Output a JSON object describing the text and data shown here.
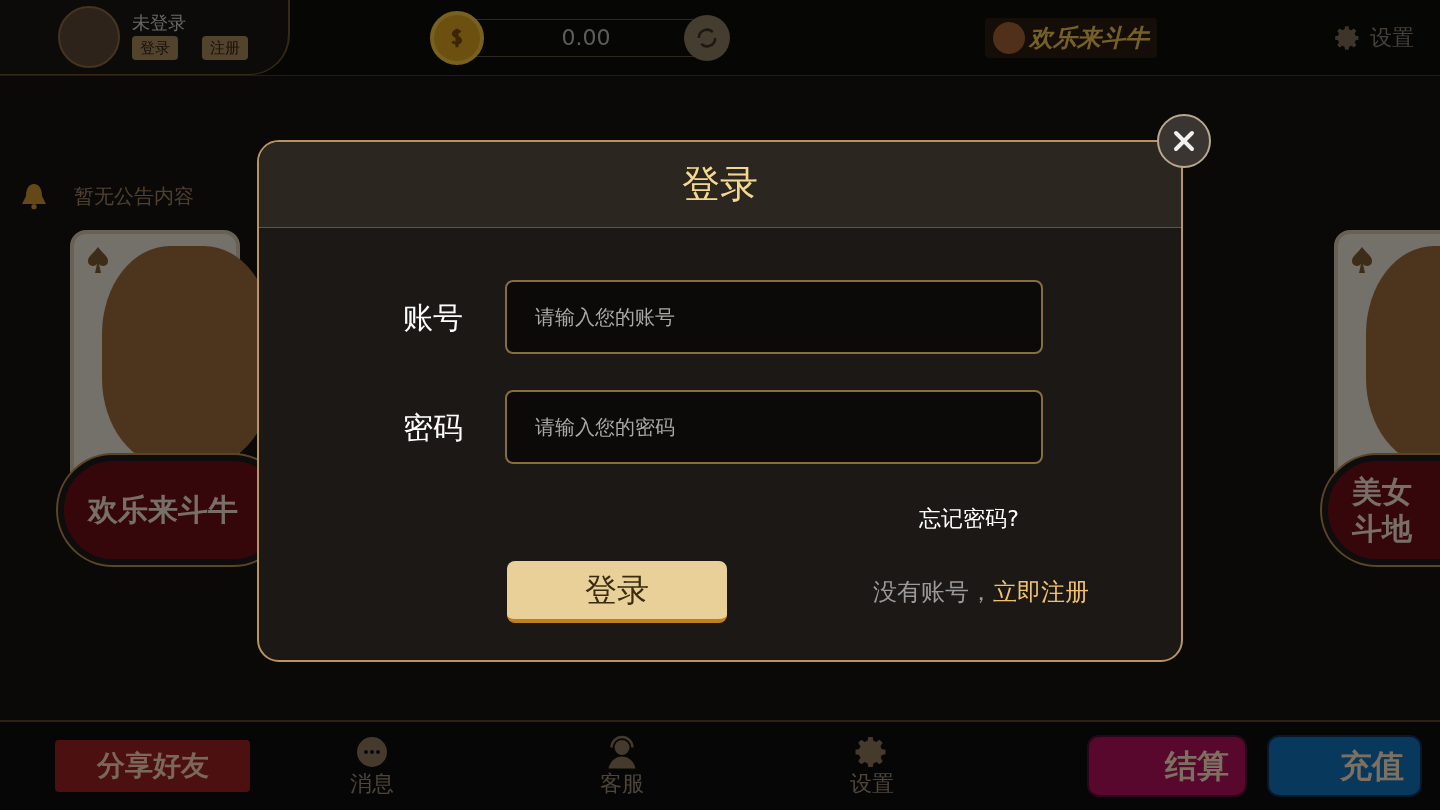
{
  "header": {
    "user_name": "未登录",
    "user_buttons": [
      "登录",
      "注册"
    ],
    "balance": "0.00",
    "logo": "欢乐来斗牛",
    "settings_label": "设置"
  },
  "notice": "暂无公告内容",
  "games": [
    {
      "lines": [
        "欢乐来斗牛"
      ]
    },
    {
      "lines": [
        "美女",
        "斗地"
      ]
    }
  ],
  "modal": {
    "title": "登录",
    "fields": [
      {
        "label": "账号",
        "placeholder": "请输入您的账号"
      },
      {
        "label": "密码",
        "placeholder": "请输入您的密码"
      }
    ],
    "forgot": "忘记密码?",
    "submit": "登录",
    "register_text": "没有账号，",
    "register_link": "立即注册"
  },
  "bottom": {
    "share": "分享好友",
    "nav": [
      {
        "label": "消息",
        "kind": "message"
      },
      {
        "label": "客服",
        "kind": "support"
      },
      {
        "label": "设置",
        "kind": "settings"
      }
    ],
    "settle": "结算",
    "recharge": "充值"
  }
}
